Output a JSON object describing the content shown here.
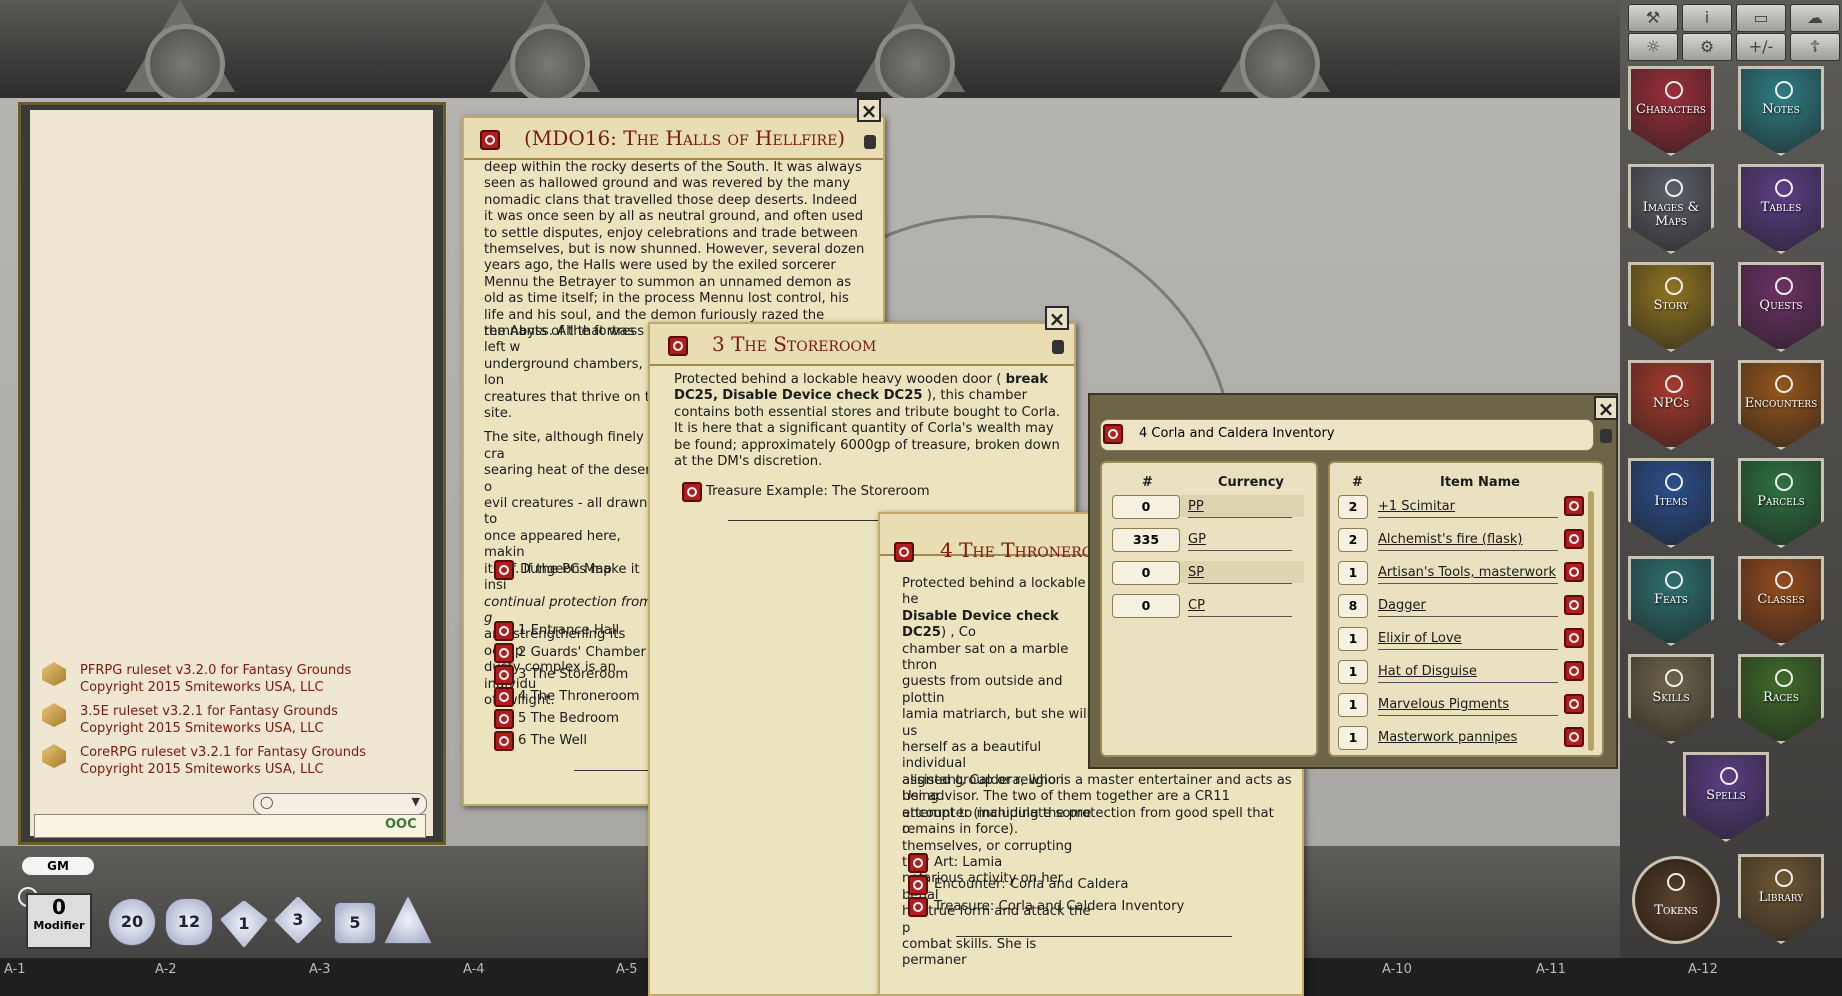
{
  "chat": {
    "lines": [
      {
        "name": "PFRPG ruleset v3.2.0 for Fantasy Grounds",
        "copyright": "Copyright 2015 Smiteworks USA, LLC"
      },
      {
        "name": "3.5E ruleset v3.2.1 for Fantasy Grounds",
        "copyright": "Copyright 2015 Smiteworks USA, LLC"
      },
      {
        "name": "CoreRPG ruleset v3.2.1 for Fantasy Grounds",
        "copyright": "Copyright 2015 Smiteworks USA, LLC"
      }
    ],
    "ooc_label": "OOC"
  },
  "bottom": {
    "gm_label": "GM",
    "modifier_value": "0",
    "modifier_label": "Modifier",
    "dice": [
      "d20",
      "d12",
      "d10",
      "d8",
      "d6",
      "d4"
    ],
    "grid_labels": [
      "A-1",
      "A-2",
      "A-3",
      "A-4",
      "A-5",
      "A-10",
      "A-11",
      "A-12"
    ]
  },
  "story1": {
    "title": "(MDO16: The Halls of Hellfire)",
    "p1": "deep within the rocky deserts of the South. It was always seen as hallowed ground and was revered by the many nomadic clans that travelled those deep deserts. Indeed it was once seen by all as neutral ground, and often used to settle disputes, enjoy celebrations and trade between themselves, but is now shunned. However, several dozen years ago, the Halls were used by the exiled sorcerer Mennu the Betrayer to summon an unnamed demon as old as time itself; in the process Mennu lost control, his life and his soul, and the demon furiously razed the remnants of the fortress to",
    "p1b": "the Abyss. All that was left w",
    "p1c": "underground chambers, lon",
    "p1d": "creatures that thrive on th",
    "p1e": "site.",
    "p2a": "The site, although finely cra",
    "p2b": "searing heat of the desert o",
    "p2c": "evil creatures - all drawn to",
    "p2d": "once appeared here, makin",
    "p2e": "itself. If the PCs make it insi",
    "p2f": "continual protection from g",
    "p2g": "and strengthening its occup",
    "p2h": "dusty complex is an individu",
    "p2i": "of Twilight.",
    "map_link": "Dungeon Map",
    "links": [
      "1 Entrance Hall",
      "2 Guards' Chamber",
      "3 The Storeroom",
      "4 The Throneroom",
      "5 The Bedroom",
      "6 The Well"
    ]
  },
  "story2": {
    "title": "3 The Storeroom",
    "t1": "Protected behind a lockable heavy wooden door (",
    "b1": "break DC25,",
    "b2": "Disable Device check DC25",
    "t2": "), this chamber contains both essential stores and tribute bought to Corla. It is here that a significant quantity of Corla's wealth may be found; approximately 6000gp of treasure, broken down at the DM's discretion.",
    "link": "Treasure Example: The Storeroom"
  },
  "story3": {
    "title": "4 The Throneroom",
    "l1": "Protected behind a lockable he",
    "l2b": "Disable Device check DC25",
    "l2": ") , Co",
    "l3": "chamber sat on a marble thron",
    "l4": "guests from outside and plottin",
    "l5": "lamia matriarch, but she will us",
    "l6": "herself as a beautiful individual",
    "l7": "aligned group or religion. Using",
    "l8": "attempt to manipulate some o",
    "l9": "themselves, or corrupting ther",
    "l10": "nefarious activity on her behal",
    "l11": "her true form and attack the p",
    "l12": "combat skills. She is permaner",
    "tail": "assistant, Caldera, who is a master entertainer and acts as her advisor. The two of them together are a CR11 encounter (including the protection from good spell that remains in force).",
    "links": [
      "Art: Lamia",
      "Encounter: Corla and Caldera",
      "Treasure: Corla and Caldera Inventory"
    ]
  },
  "inventory": {
    "title": "4 Corla and Caldera Inventory",
    "currency_hdr_num": "#",
    "currency_hdr": "Currency",
    "currency": [
      {
        "amount": "0",
        "name": "PP"
      },
      {
        "amount": "335",
        "name": "GP"
      },
      {
        "amount": "0",
        "name": "SP"
      },
      {
        "amount": "0",
        "name": "CP"
      }
    ],
    "items_hdr_num": "#",
    "items_hdr": "Item Name",
    "items": [
      {
        "count": "2",
        "name": "+1 Scimitar"
      },
      {
        "count": "2",
        "name": "Alchemist's fire (flask)"
      },
      {
        "count": "1",
        "name": "Artisan's Tools, masterwork"
      },
      {
        "count": "8",
        "name": "Dagger"
      },
      {
        "count": "1",
        "name": "Elixir of Love"
      },
      {
        "count": "1",
        "name": "Hat of Disguise"
      },
      {
        "count": "1",
        "name": "Marvelous Pigments"
      },
      {
        "count": "1",
        "name": "Masterwork pannipes"
      }
    ]
  },
  "sidebar": {
    "buttons": [
      {
        "label": "Characters",
        "color": "#9b2e3b"
      },
      {
        "label": "Notes",
        "color": "#2f7d84"
      },
      {
        "label": "Images & Maps",
        "color": "#5d6068"
      },
      {
        "label": "Tables",
        "color": "#5c3f86"
      },
      {
        "label": "Story",
        "color": "#8f7422"
      },
      {
        "label": "Quests",
        "color": "#6c3266"
      },
      {
        "label": "NPCs",
        "color": "#a63a2c"
      },
      {
        "label": "Encounters",
        "color": "#95561c"
      },
      {
        "label": "Items",
        "color": "#2c4e8c"
      },
      {
        "label": "Parcels",
        "color": "#2f7142"
      },
      {
        "label": "Feats",
        "color": "#2e6f6e"
      },
      {
        "label": "Classes",
        "color": "#944b1f"
      },
      {
        "label": "Skills",
        "color": "#6f654c"
      },
      {
        "label": "Races",
        "color": "#3f6b2a"
      },
      {
        "label": "Spells",
        "color": "#5a3e84"
      },
      {
        "label": "Tokens",
        "color": "#3b2a1e"
      },
      {
        "label": "Library",
        "color": "#6e5634"
      }
    ],
    "tool_icons": [
      "tools-icon",
      "info-icon",
      "book-icon",
      "cloud-icon",
      "light-icon",
      "settings-icon",
      "plusminus-icon",
      "figure-icon"
    ],
    "tool_labels": [
      "⚒",
      "i",
      "▭",
      "☁",
      "☼",
      "⚙",
      "+/-",
      "☦"
    ]
  }
}
